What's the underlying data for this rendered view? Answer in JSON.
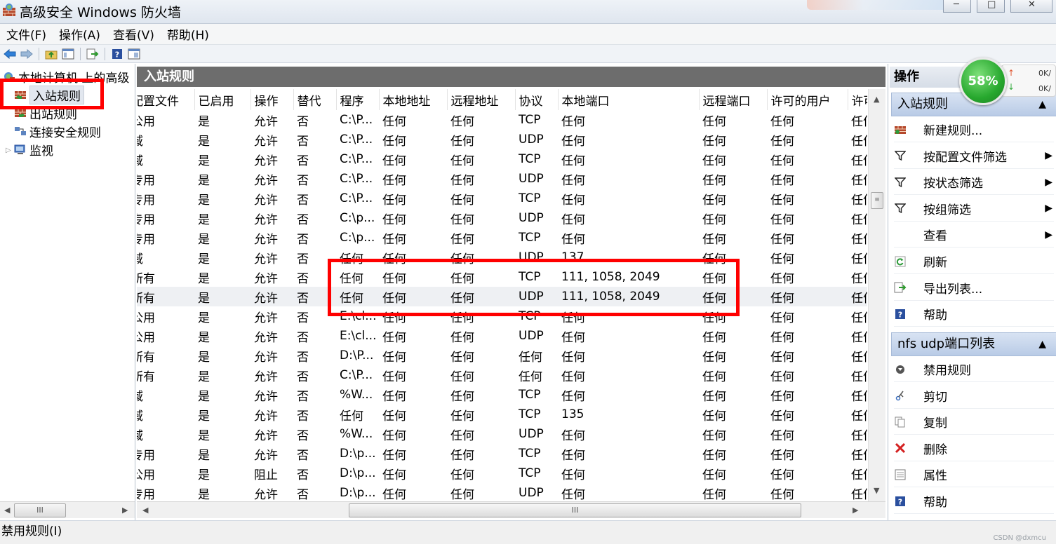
{
  "window": {
    "title": "高级安全 Windows 防火墙",
    "min_glyph": "─",
    "max_glyph": "□",
    "close_glyph": "✕"
  },
  "menu": [
    "文件(F)",
    "操作(A)",
    "查看(V)",
    "帮助(H)"
  ],
  "toolbar": {
    "icons": [
      "back-icon",
      "forward-icon",
      "folder-up-icon",
      "show-hide-tree-icon",
      "export-icon",
      "help-icon",
      "properties-icon"
    ]
  },
  "tree": {
    "root": "本地计算机 上的高级",
    "items": [
      {
        "label": "入站规则",
        "icon": "inbound-rules-icon",
        "selected": true
      },
      {
        "label": "出站规则",
        "icon": "outbound-rules-icon"
      },
      {
        "label": "连接安全规则",
        "icon": "connection-security-icon"
      },
      {
        "label": "监视",
        "icon": "monitor-icon"
      }
    ]
  },
  "center": {
    "header": "入站规则",
    "columns": [
      "配置文件",
      "已启用",
      "操作",
      "替代",
      "程序",
      "本地地址",
      "远程地址",
      "协议",
      "本地端口",
      "远程端口",
      "许可的用户",
      "许可"
    ],
    "rows": [
      [
        "公用",
        "是",
        "允许",
        "否",
        "C:\\P...",
        "任何",
        "任何",
        "TCP",
        "任何",
        "任何",
        "任何",
        "任何"
      ],
      [
        "域",
        "是",
        "允许",
        "否",
        "C:\\P...",
        "任何",
        "任何",
        "UDP",
        "任何",
        "任何",
        "任何",
        "任何"
      ],
      [
        "域",
        "是",
        "允许",
        "否",
        "C:\\P...",
        "任何",
        "任何",
        "TCP",
        "任何",
        "任何",
        "任何",
        "任何"
      ],
      [
        "专用",
        "是",
        "允许",
        "否",
        "C:\\P...",
        "任何",
        "任何",
        "UDP",
        "任何",
        "任何",
        "任何",
        "任何"
      ],
      [
        "专用",
        "是",
        "允许",
        "否",
        "C:\\P...",
        "任何",
        "任何",
        "TCP",
        "任何",
        "任何",
        "任何",
        "任何"
      ],
      [
        "专用",
        "是",
        "允许",
        "否",
        "C:\\p...",
        "任何",
        "任何",
        "UDP",
        "任何",
        "任何",
        "任何",
        "任何"
      ],
      [
        "专用",
        "是",
        "允许",
        "否",
        "C:\\p...",
        "任何",
        "任何",
        "TCP",
        "任何",
        "任何",
        "任何",
        "任何"
      ],
      [
        "域",
        "是",
        "允许",
        "否",
        "任何",
        "任何",
        "任何",
        "UDP",
        "137",
        "任何",
        "任何",
        "任何"
      ],
      [
        "所有",
        "是",
        "允许",
        "否",
        "任何",
        "任何",
        "任何",
        "TCP",
        "111, 1058, 2049",
        "任何",
        "任何",
        "任何"
      ],
      [
        "所有",
        "是",
        "允许",
        "否",
        "任何",
        "任何",
        "任何",
        "UDP",
        "111, 1058, 2049",
        "任何",
        "任何",
        "任何"
      ],
      [
        "公用",
        "是",
        "允许",
        "否",
        "E:\\cl...",
        "任何",
        "任何",
        "TCP",
        "任何",
        "任何",
        "任何",
        "任何"
      ],
      [
        "公用",
        "是",
        "允许",
        "否",
        "E:\\cl...",
        "任何",
        "任何",
        "UDP",
        "任何",
        "任何",
        "任何",
        "任何"
      ],
      [
        "所有",
        "是",
        "允许",
        "否",
        "D:\\P...",
        "任何",
        "任何",
        "任何",
        "任何",
        "任何",
        "任何",
        "任何"
      ],
      [
        "所有",
        "是",
        "允许",
        "否",
        "C:\\P...",
        "任何",
        "任何",
        "任何",
        "任何",
        "任何",
        "任何",
        "任何"
      ],
      [
        "域",
        "是",
        "允许",
        "否",
        "%W...",
        "任何",
        "任何",
        "TCP",
        "任何",
        "任何",
        "任何",
        "任何"
      ],
      [
        "域",
        "是",
        "允许",
        "否",
        "任何",
        "任何",
        "任何",
        "TCP",
        "135",
        "任何",
        "任何",
        "任何"
      ],
      [
        "域",
        "是",
        "允许",
        "否",
        "%W...",
        "任何",
        "任何",
        "UDP",
        "任何",
        "任何",
        "任何",
        "任何"
      ],
      [
        "专用",
        "是",
        "允许",
        "否",
        "D:\\p...",
        "任何",
        "任何",
        "TCP",
        "任何",
        "任何",
        "任何",
        "任何"
      ],
      [
        "公用",
        "是",
        "阻止",
        "否",
        "D:\\p...",
        "任何",
        "任何",
        "TCP",
        "任何",
        "任何",
        "任何",
        "任何"
      ],
      [
        "专用",
        "是",
        "允许",
        "否",
        "D:\\p...",
        "任何",
        "任何",
        "UDP",
        "任何",
        "任何",
        "任何",
        "任何"
      ]
    ],
    "highlighted_rows": [
      8,
      9
    ]
  },
  "actions": {
    "title": "操作",
    "section1": {
      "label": "入站规则",
      "items": [
        {
          "label": "新建规则...",
          "icon": "new-rule-icon",
          "submenu": false
        },
        {
          "label": "按配置文件筛选",
          "icon": "filter-icon",
          "submenu": true
        },
        {
          "label": "按状态筛选",
          "icon": "filter-icon",
          "submenu": true
        },
        {
          "label": "按组筛选",
          "icon": "filter-icon",
          "submenu": true
        },
        {
          "label": "查看",
          "icon": "",
          "submenu": true
        },
        {
          "label": "刷新",
          "icon": "refresh-icon",
          "submenu": false
        },
        {
          "label": "导出列表...",
          "icon": "export-list-icon",
          "submenu": false
        },
        {
          "label": "帮助",
          "icon": "help-icon",
          "submenu": false
        }
      ]
    },
    "section2": {
      "label": "nfs udp端口列表",
      "items": [
        {
          "label": "禁用规则",
          "icon": "disable-rule-icon"
        },
        {
          "label": "剪切",
          "icon": "cut-icon"
        },
        {
          "label": "复制",
          "icon": "copy-icon"
        },
        {
          "label": "删除",
          "icon": "delete-icon"
        },
        {
          "label": "属性",
          "icon": "properties-icon"
        },
        {
          "label": "帮助",
          "icon": "help-icon"
        }
      ]
    }
  },
  "net_widget": {
    "percent": "58%",
    "up": "0K/",
    "down": "0K/"
  },
  "status": {
    "text": "禁用规则(I)",
    "watermark": "CSDN @dxmcu"
  },
  "scroll_grip": "III",
  "colors": {
    "highlight_red": "#ff0000",
    "header_gray": "#6d6d6d",
    "section_blue": "#c9d8ee",
    "gauge_green": "#27a82e"
  }
}
